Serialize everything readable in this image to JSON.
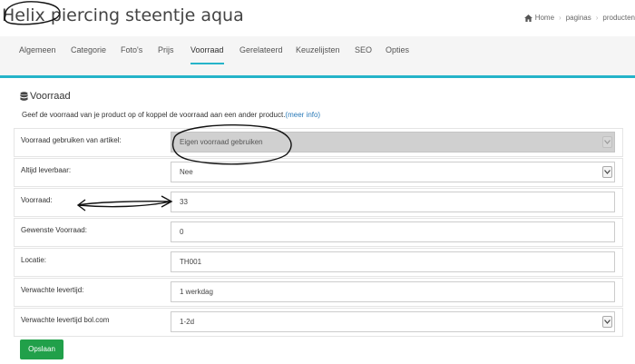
{
  "header": {
    "title": "Helix piercing steentje aqua",
    "breadcrumb": [
      "Home",
      "paginas",
      "producten"
    ]
  },
  "tabs": [
    {
      "label": "Algemeen",
      "active": false
    },
    {
      "label": "Categorie",
      "active": false
    },
    {
      "label": "Foto's",
      "active": false
    },
    {
      "label": "Prijs",
      "active": false
    },
    {
      "label": "Voorraad",
      "active": true
    },
    {
      "label": "Gerelateerd",
      "active": false
    },
    {
      "label": "Keuzelijsten",
      "active": false
    },
    {
      "label": "SEO",
      "active": false
    },
    {
      "label": "Opties",
      "active": false
    }
  ],
  "panel": {
    "title": "Voorraad",
    "icon": "database-icon",
    "description": "Geef de voorraad van je product op of koppel de voorraad aan een ander product.",
    "link_text": "(meer info)"
  },
  "fields": {
    "use_stock": {
      "label": "Voorraad gebruiken van artikel:",
      "value": "Eigen voorraad gebruiken"
    },
    "always_available": {
      "label": "Altijd leverbaar:",
      "value": "Nee"
    },
    "stock": {
      "label": "Voorraad:",
      "value": "33"
    },
    "desired_stock": {
      "label": "Gewenste Voorraad:",
      "value": "0"
    },
    "location": {
      "label": "Locatie:",
      "value": "TH001"
    },
    "delivery_time": {
      "label": "Verwachte levertijd:",
      "value": "1 werkdag"
    },
    "delivery_time_bol": {
      "label": "Verwachte levertijd bol.com",
      "value": "1-2d"
    }
  },
  "actions": {
    "save_label": "Opslaan"
  },
  "colors": {
    "accent": "#25b4c9",
    "save_button": "#21a04a",
    "link": "#2a7ab8"
  }
}
